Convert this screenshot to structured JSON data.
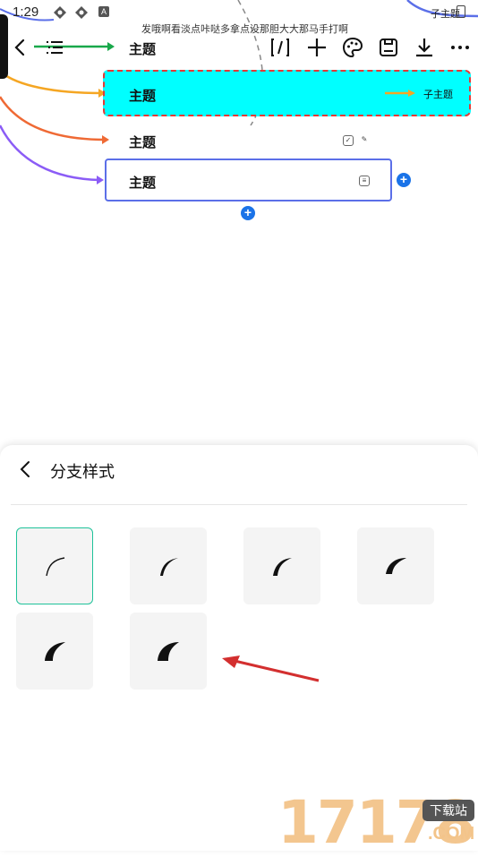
{
  "status_bar": {
    "time": "1:29",
    "a_badge": "A",
    "right_topic": "子主题"
  },
  "document": {
    "title": "发哦啊看淡点咔哒多拿点没那胆大大那马手打啊"
  },
  "toolbar": {
    "root_topic": "主题",
    "icons": [
      "back-icon",
      "outline-icon",
      "format-icon",
      "add-icon",
      "palette-icon",
      "save-icon",
      "download-icon",
      "more-icon"
    ]
  },
  "mindmap": {
    "nodes": [
      {
        "label": "主题",
        "child_label": "子主题"
      },
      {
        "label": "主题"
      },
      {
        "label": "主题"
      }
    ],
    "colors": {
      "green": "#19a84a",
      "orange": "#f5a623",
      "red_orange": "#ef6a35",
      "purple": "#8b5cf6",
      "selected_fill": "#00ffff",
      "selected_border": "#e53935",
      "outline_border": "#5b6fe8",
      "add_button": "#1a73e8"
    }
  },
  "panel": {
    "title": "分支样式",
    "styles": [
      {
        "name": "branch-style-1",
        "selected": true
      },
      {
        "name": "branch-style-2",
        "selected": false
      },
      {
        "name": "branch-style-3",
        "selected": false
      },
      {
        "name": "branch-style-4",
        "selected": false
      },
      {
        "name": "branch-style-5",
        "selected": false
      },
      {
        "name": "branch-style-6",
        "selected": false
      }
    ],
    "selected_border_color": "#1fc29a"
  },
  "watermark": {
    "number": "17178",
    "badge": "下载站",
    "suffix": ".COM"
  }
}
